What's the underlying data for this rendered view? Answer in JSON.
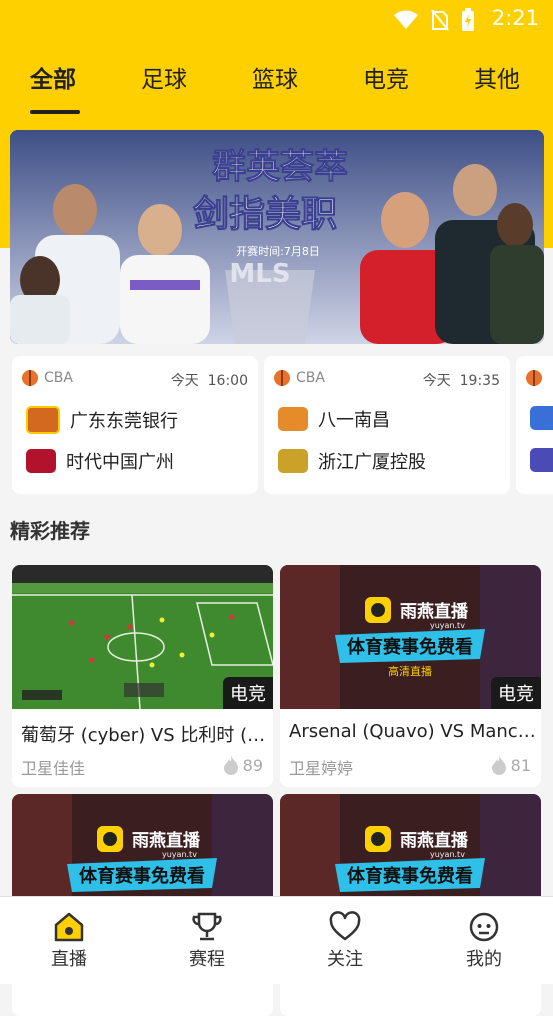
{
  "status_bar": {
    "time": "2:21"
  },
  "tabs": [
    {
      "label": "全部",
      "active": true
    },
    {
      "label": "足球"
    },
    {
      "label": "篮球"
    },
    {
      "label": "电竞"
    },
    {
      "label": "其他"
    }
  ],
  "banner": {
    "headline_1": "群英荟萃",
    "headline_2": "剑指美职",
    "subtitle": "开赛时间:7月8日",
    "logo_text": "MLS",
    "slide_count": 8,
    "active_slide": 2
  },
  "matches": [
    {
      "league": "CBA",
      "day": "今天",
      "time": "16:00",
      "home": "广东东莞银行",
      "away": "时代中国广州"
    },
    {
      "league": "CBA",
      "day": "今天",
      "time": "19:35",
      "home": "八一南昌",
      "away": "浙江广厦控股"
    }
  ],
  "recommend": {
    "title": "精彩推荐",
    "videos": [
      {
        "title": "葡萄牙 (cyber) VS 比利时 (cyber)",
        "author": "卫星佳佳",
        "heat": "89",
        "tag": "电竞",
        "thumb": "football-game"
      },
      {
        "title": "Arsenal (Quavo) VS Manchester",
        "author": "卫星婷婷",
        "heat": "81",
        "tag": "电竞",
        "thumb": "yuyan-poster"
      },
      {
        "title": "",
        "author": "",
        "heat": "",
        "tag": "",
        "thumb": "yuyan-poster"
      },
      {
        "title": "",
        "author": "",
        "heat": "",
        "tag": "",
        "thumb": "yuyan-poster"
      }
    ],
    "poster": {
      "brand": "雨燕直播",
      "site": "yuyan.tv",
      "slogan": "体育赛事免费看",
      "sub": "高清直播"
    }
  },
  "bottom_nav": [
    {
      "label": "直播",
      "icon": "home-icon"
    },
    {
      "label": "赛程",
      "icon": "trophy-icon"
    },
    {
      "label": "关注",
      "icon": "heart-icon"
    },
    {
      "label": "我的",
      "icon": "face-icon"
    }
  ],
  "colors": {
    "brand": "#ffd000",
    "accent": "#ffb300"
  }
}
